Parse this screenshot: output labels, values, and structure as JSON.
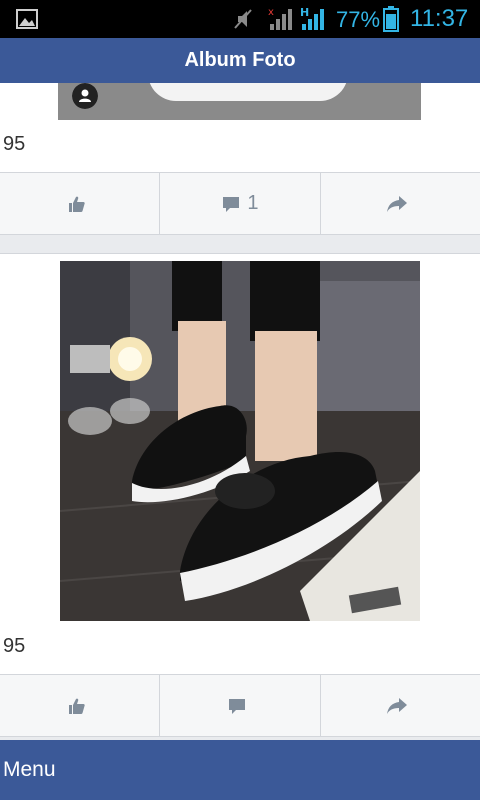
{
  "status_bar": {
    "notification_icon": "image-icon",
    "battery_percent": "77%",
    "time": "11:37",
    "network_type": "H",
    "colors": {
      "background": "#000000",
      "icons": "#33b5e5"
    }
  },
  "app_bar": {
    "title": "Album Foto",
    "color": "#3b5998"
  },
  "posts": [
    {
      "caption": "95",
      "actions": [
        {
          "name": "like",
          "icon": "thumbs-up-icon",
          "count": ""
        },
        {
          "name": "comment",
          "icon": "comment-icon",
          "count": "1"
        },
        {
          "name": "share",
          "icon": "share-arrow-icon",
          "count": ""
        }
      ]
    },
    {
      "caption": "95",
      "photo": "black slip-on sneakers with bows on white soles",
      "actions": [
        {
          "name": "like",
          "icon": "thumbs-up-icon",
          "count": ""
        },
        {
          "name": "comment",
          "icon": "comment-icon",
          "count": ""
        },
        {
          "name": "share",
          "icon": "share-arrow-icon",
          "count": ""
        }
      ]
    }
  ],
  "bottom_bar": {
    "menu_label": "Menu"
  }
}
